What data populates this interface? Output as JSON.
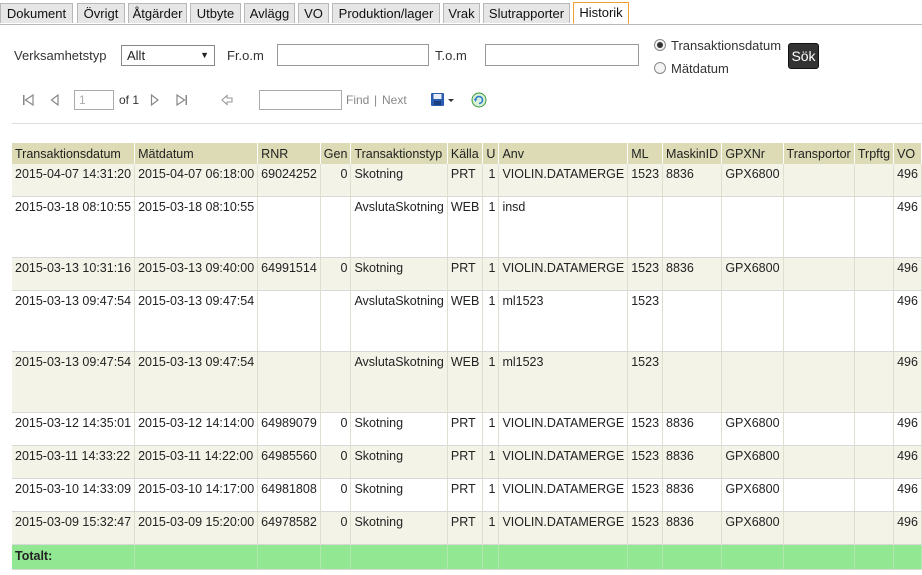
{
  "tabs": [
    "Dokument",
    "Övrigt",
    "Åtgärder",
    "Utbyte",
    "Avlägg",
    "VO",
    "Produktion/lager",
    "Vrak",
    "Slutrapporter",
    "Historik"
  ],
  "active_tab": "Historik",
  "form": {
    "verksamhetstyp_label": "Verksamhetstyp",
    "verksamhetstyp_value": "Allt",
    "from_label": "Fr.o.m",
    "from_value": "",
    "tom_label": "T.o.m",
    "tom_value": "",
    "radio_transaktion": "Transaktionsdatum",
    "radio_matdatum": "Mätdatum",
    "selected_radio": "Transaktionsdatum",
    "search_button": "Sök"
  },
  "pager": {
    "page_value": "1",
    "of_label": "of 1",
    "find_label": "Find",
    "separator": "|",
    "next_label": "Next"
  },
  "table": {
    "columns": [
      "Transaktionsdatum",
      "Mätdatum",
      "RNR",
      "Gen",
      "Transaktionstyp",
      "Källa",
      "U",
      "Anv",
      "ML",
      "MaskinID",
      "GPXNr",
      "Transportor",
      "Trpftg",
      "VO"
    ],
    "rows": [
      {
        "Transaktionsdatum": "2015-04-07 14:31:20",
        "Mätdatum": "2015-04-07 06:18:00",
        "RNR": "69024252",
        "Gen": "0",
        "Transaktionstyp": "Skotning",
        "Källa": "PRT",
        "U": "1",
        "Anv": "VIOLIN.DATAMERGE",
        "ML": "1523",
        "MaskinID": "8836",
        "GPXNr": "GPX6800",
        "Transportor": "",
        "Trpftg": "",
        "VO": "496"
      },
      {
        "Transaktionsdatum": "2015-03-18 08:10:55",
        "Mätdatum": "2015-03-18 08:10:55",
        "RNR": "",
        "Gen": "",
        "Transaktionstyp": "AvslutaSkotning",
        "Källa": "WEB",
        "U": "1",
        "Anv": "insd",
        "ML": "",
        "MaskinID": "",
        "GPXNr": "",
        "Transportor": "",
        "Trpftg": "",
        "VO": "496"
      },
      {
        "Transaktionsdatum": "2015-03-13 10:31:16",
        "Mätdatum": "2015-03-13 09:40:00",
        "RNR": "64991514",
        "Gen": "0",
        "Transaktionstyp": "Skotning",
        "Källa": "PRT",
        "U": "1",
        "Anv": "VIOLIN.DATAMERGE",
        "ML": "1523",
        "MaskinID": "8836",
        "GPXNr": "GPX6800",
        "Transportor": "",
        "Trpftg": "",
        "VO": "496"
      },
      {
        "Transaktionsdatum": "2015-03-13 09:47:54",
        "Mätdatum": "2015-03-13 09:47:54",
        "RNR": "",
        "Gen": "",
        "Transaktionstyp": "AvslutaSkotning",
        "Källa": "WEB",
        "U": "1",
        "Anv": "ml1523",
        "ML": "1523",
        "MaskinID": "",
        "GPXNr": "",
        "Transportor": "",
        "Trpftg": "",
        "VO": "496"
      },
      {
        "Transaktionsdatum": "2015-03-13 09:47:54",
        "Mätdatum": "2015-03-13 09:47:54",
        "RNR": "",
        "Gen": "",
        "Transaktionstyp": "AvslutaSkotning",
        "Källa": "WEB",
        "U": "1",
        "Anv": "ml1523",
        "ML": "1523",
        "MaskinID": "",
        "GPXNr": "",
        "Transportor": "",
        "Trpftg": "",
        "VO": "496"
      },
      {
        "Transaktionsdatum": "2015-03-12 14:35:01",
        "Mätdatum": "2015-03-12 14:14:00",
        "RNR": "64989079",
        "Gen": "0",
        "Transaktionstyp": "Skotning",
        "Källa": "PRT",
        "U": "1",
        "Anv": "VIOLIN.DATAMERGE",
        "ML": "1523",
        "MaskinID": "8836",
        "GPXNr": "GPX6800",
        "Transportor": "",
        "Trpftg": "",
        "VO": "496"
      },
      {
        "Transaktionsdatum": "2015-03-11 14:33:22",
        "Mätdatum": "2015-03-11 14:22:00",
        "RNR": "64985560",
        "Gen": "0",
        "Transaktionstyp": "Skotning",
        "Källa": "PRT",
        "U": "1",
        "Anv": "VIOLIN.DATAMERGE",
        "ML": "1523",
        "MaskinID": "8836",
        "GPXNr": "GPX6800",
        "Transportor": "",
        "Trpftg": "",
        "VO": "496"
      },
      {
        "Transaktionsdatum": "2015-03-10 14:33:09",
        "Mätdatum": "2015-03-10 14:17:00",
        "RNR": "64981808",
        "Gen": "0",
        "Transaktionstyp": "Skotning",
        "Källa": "PRT",
        "U": "1",
        "Anv": "VIOLIN.DATAMERGE",
        "ML": "1523",
        "MaskinID": "8836",
        "GPXNr": "GPX6800",
        "Transportor": "",
        "Trpftg": "",
        "VO": "496"
      },
      {
        "Transaktionsdatum": "2015-03-09 15:32:47",
        "Mätdatum": "2015-03-09 15:20:00",
        "RNR": "64978582",
        "Gen": "0",
        "Transaktionstyp": "Skotning",
        "Källa": "PRT",
        "U": "1",
        "Anv": "VIOLIN.DATAMERGE",
        "ML": "1523",
        "MaskinID": "8836",
        "GPXNr": "GPX6800",
        "Transportor": "",
        "Trpftg": "",
        "VO": "496"
      }
    ],
    "total_label": "Totalt:"
  },
  "icons": {
    "first_page": "first-page-icon",
    "prev_page": "prev-page-icon",
    "next_page": "next-page-icon",
    "last_page": "last-page-icon",
    "back": "back-icon",
    "export": "save-export-icon",
    "refresh": "refresh-icon"
  },
  "colors": {
    "header_bg": "#dcdbb5",
    "alt_row_bg": "#f4f3e8",
    "total_row_bg": "#92e892",
    "active_tab_border": "#f0a030",
    "search_button_bg": "#333333"
  }
}
